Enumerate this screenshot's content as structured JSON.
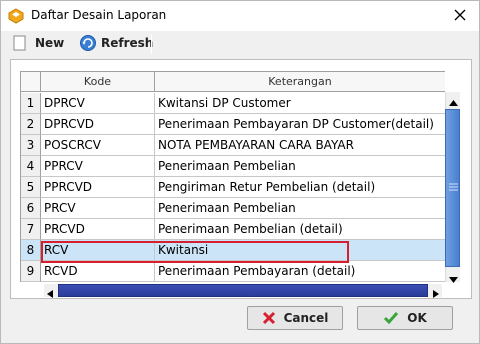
{
  "window": {
    "title": "Daftar Desain Laporan"
  },
  "toolbar": {
    "new_label": "New",
    "refresh_label": "Refresh"
  },
  "grid": {
    "columns": [
      "Kode",
      "Keterangan"
    ],
    "rows": [
      {
        "num": "1",
        "kode": "DPRCV",
        "keterangan": "Kwitansi DP Customer"
      },
      {
        "num": "2",
        "kode": "DPRCVD",
        "keterangan": "Penerimaan Pembayaran DP Customer(detail)"
      },
      {
        "num": "3",
        "kode": "POSCRCV",
        "keterangan": "NOTA PEMBAYARAN CARA BAYAR"
      },
      {
        "num": "4",
        "kode": "PPRCV",
        "keterangan": "Penerimaan Pembelian"
      },
      {
        "num": "5",
        "kode": "PPRCVD",
        "keterangan": "Pengiriman Retur Pembelian (detail)"
      },
      {
        "num": "6",
        "kode": "PRCV",
        "keterangan": "Penerimaan Pembelian"
      },
      {
        "num": "7",
        "kode": "PRCVD",
        "keterangan": "Penerimaan Pembelian (detail)"
      },
      {
        "num": "8",
        "kode": "RCV",
        "keterangan": "Kwitansi",
        "selected": true
      },
      {
        "num": "9",
        "kode": "RCVD",
        "keterangan": "Penerimaan Pembayaran (detail)"
      }
    ]
  },
  "buttons": {
    "cancel_label": "Cancel",
    "ok_label": "OK"
  },
  "colors": {
    "selection": "#cce4f7",
    "highlight_border": "#d62030",
    "scroll_thumb": "#4a7fd0"
  }
}
